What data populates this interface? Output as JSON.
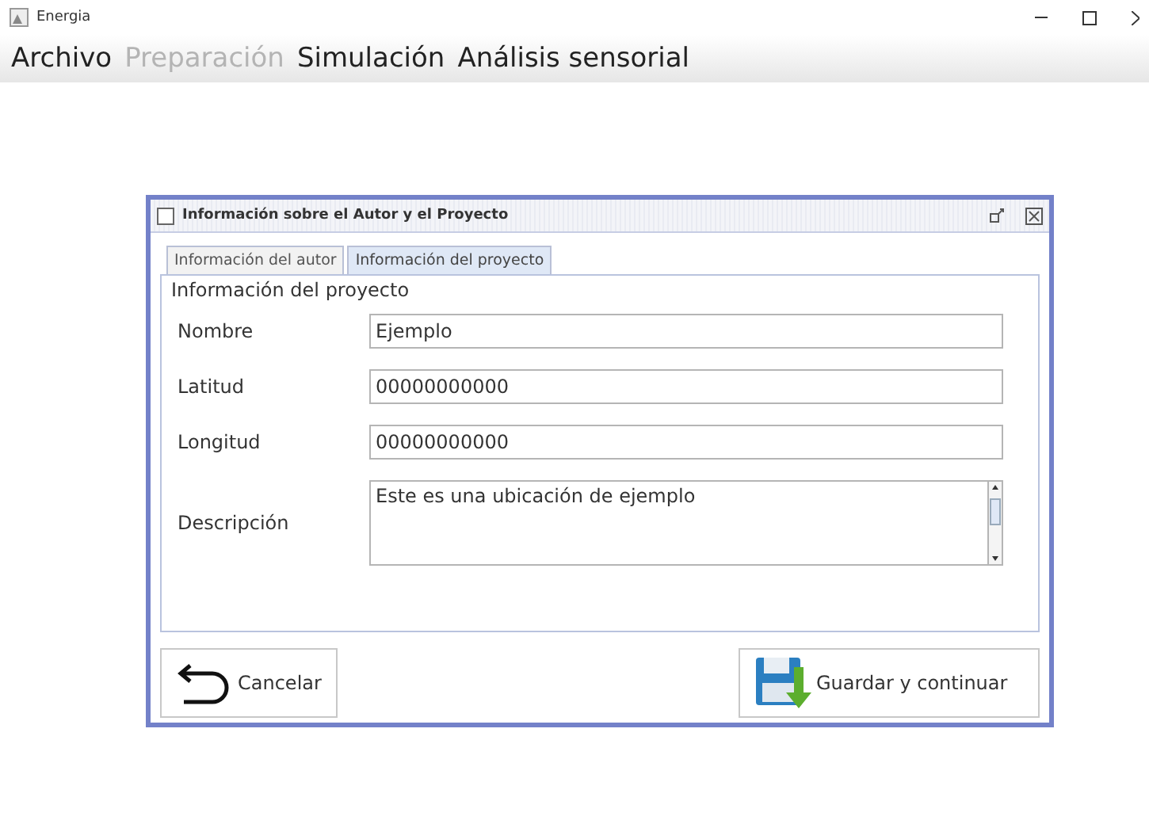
{
  "window": {
    "title": "Energia"
  },
  "menu": [
    {
      "label": "Archivo",
      "disabled": false
    },
    {
      "label": "Preparación",
      "disabled": true
    },
    {
      "label": "Simulación",
      "disabled": false
    },
    {
      "label": "Análisis sensorial",
      "disabled": false
    }
  ],
  "dialog": {
    "title": "Información sobre el Autor y el Proyecto",
    "tabs": [
      {
        "label": "Información del autor",
        "selected": false
      },
      {
        "label": "Información del proyecto",
        "selected": true
      }
    ],
    "group_title": "Información del proyecto",
    "fields": [
      {
        "label": "Nombre",
        "value": "Ejemplo",
        "kind": "text"
      },
      {
        "label": "Latitud",
        "value": "00000000000",
        "kind": "text"
      },
      {
        "label": "Longitud",
        "value": "00000000000",
        "kind": "text"
      },
      {
        "label": "Descripción",
        "value": "Este es una ubicación de ejemplo",
        "kind": "textarea"
      }
    ],
    "buttons": [
      {
        "label": "Cancelar",
        "kind": "cancel"
      },
      {
        "label": "Guardar y continuar",
        "kind": "save"
      }
    ]
  }
}
